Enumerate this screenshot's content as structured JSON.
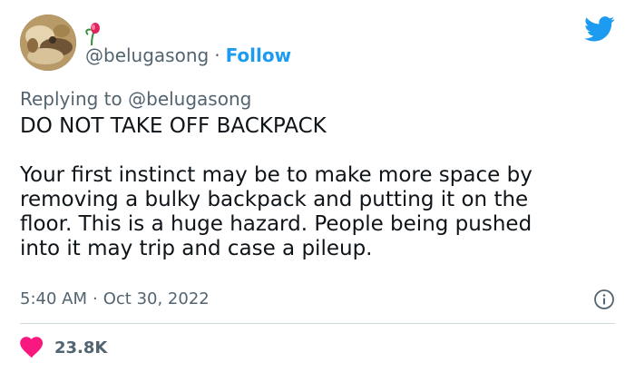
{
  "author": {
    "handle": "@belugasong",
    "separator": "·",
    "follow_label": "Follow",
    "avatar_icon": "avatar-painting",
    "badge_icon": "flower-badge-icon"
  },
  "reply": {
    "prefix": "Replying to",
    "mention": "@belugasong"
  },
  "tweet": {
    "line1": "DO NOT TAKE OFF BACKPACK",
    "body": "Your first instinct may be to make more space by\nremoving a bulky backpack and putting it on the\nfloor. This is a huge hazard. People being pushed\ninto it may trip and case a pileup."
  },
  "meta": {
    "time": "5:40 AM",
    "separator": "·",
    "date": "Oct 30, 2022"
  },
  "engagement": {
    "likes": "23.8K"
  },
  "colors": {
    "accent": "#1d9bf0",
    "like": "#f91880",
    "muted": "#536471",
    "text": "#0f1419",
    "divider": "#cfd9de"
  }
}
